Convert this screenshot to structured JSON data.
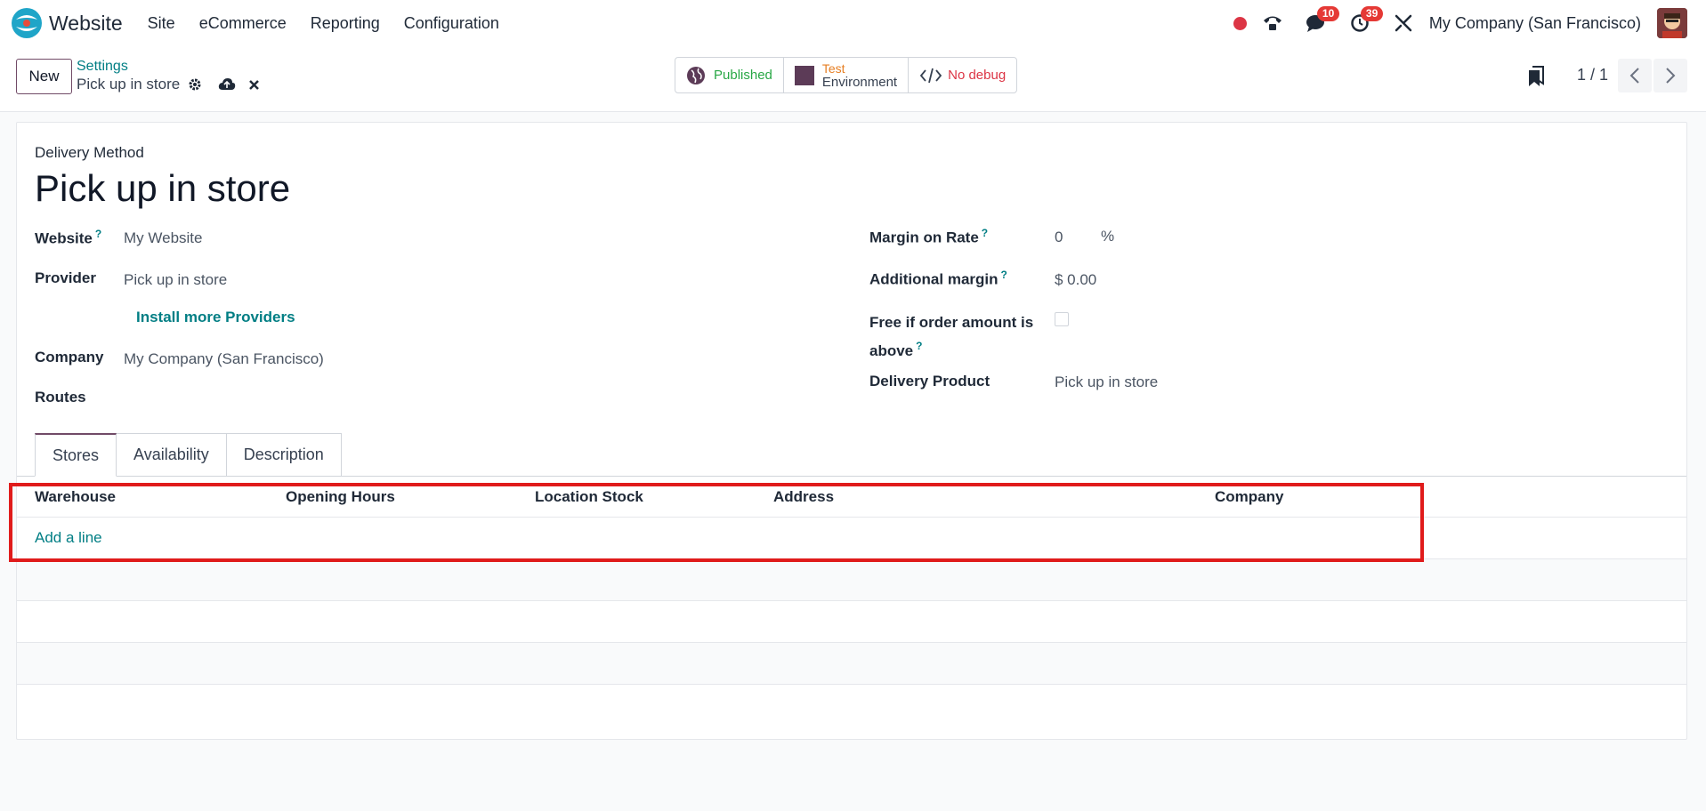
{
  "app": {
    "name": "Website",
    "menu": [
      "Site",
      "eCommerce",
      "Reporting",
      "Configuration"
    ]
  },
  "systray": {
    "messages_count": "10",
    "activities_count": "39",
    "company": "My Company (San Francisco)"
  },
  "control_panel": {
    "new_label": "New",
    "breadcrumb": "Settings",
    "record_name": "Pick up in store",
    "status": {
      "published": "Published",
      "env_test": "Test",
      "env_label": "Environment",
      "debug": "No debug"
    },
    "pager": "1 / 1"
  },
  "form": {
    "overline": "Delivery Method",
    "title": "Pick up in store",
    "left": {
      "website_label": "Website",
      "website_value": "My Website",
      "provider_label": "Provider",
      "provider_value": "Pick up in store",
      "install_link": "Install more Providers",
      "company_label": "Company",
      "company_value": "My Company (San Francisco)",
      "routes_label": "Routes"
    },
    "right": {
      "margin_rate_label": "Margin on Rate",
      "margin_rate_value": "0",
      "margin_rate_unit": "%",
      "additional_margin_label": "Additional margin",
      "additional_margin_value": "$ 0.00",
      "free_label_1": "Free if order amount is",
      "free_label_2": "above",
      "free_checked": false,
      "delivery_product_label": "Delivery Product",
      "delivery_product_value": "Pick up in store"
    },
    "help_mark": "?",
    "tabs": [
      "Stores",
      "Availability",
      "Description"
    ],
    "grid": {
      "columns": [
        "Warehouse",
        "Opening Hours",
        "Location Stock",
        "Address",
        "Company"
      ],
      "add_line": "Add a line"
    }
  },
  "colors": {
    "accent": "#714b67",
    "link": "#017e84",
    "highlight": "#e01b1b"
  }
}
